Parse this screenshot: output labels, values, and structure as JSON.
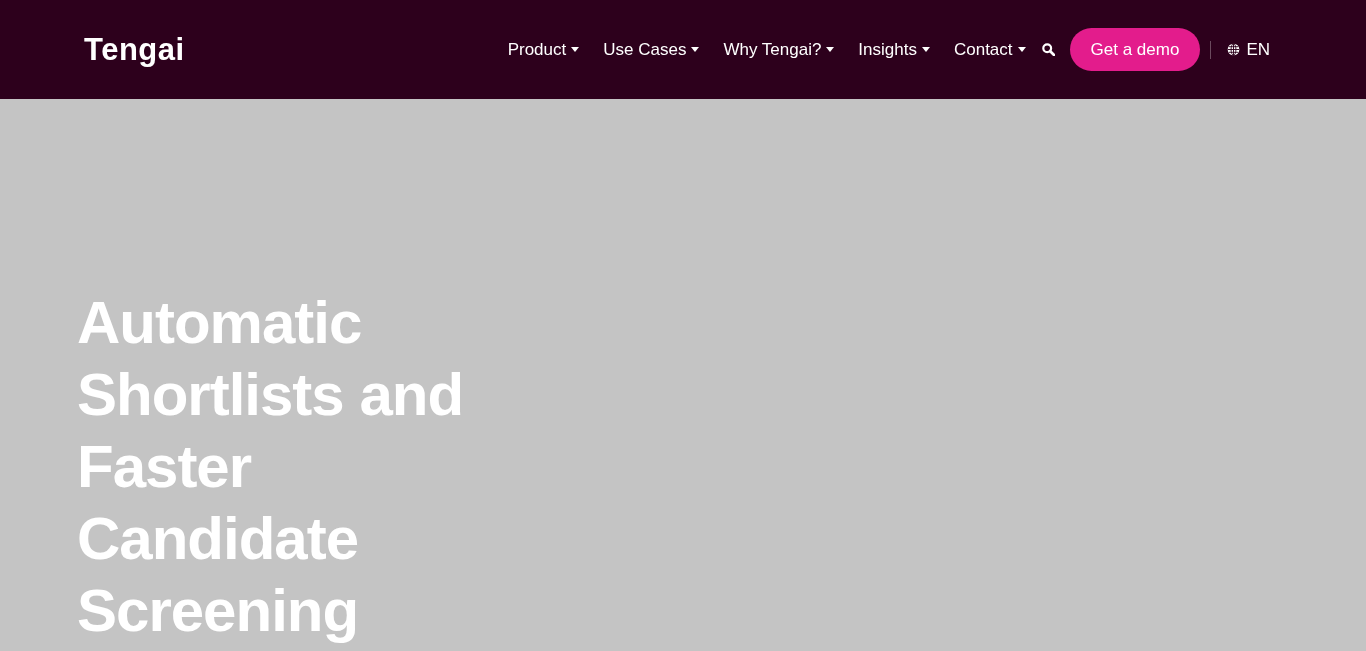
{
  "header": {
    "logo": "Tengai",
    "nav": [
      {
        "label": "Product"
      },
      {
        "label": "Use Cases"
      },
      {
        "label": "Why Tengai?"
      },
      {
        "label": "Insights"
      },
      {
        "label": "Contact"
      }
    ],
    "cta": "Get a demo",
    "language": "EN"
  },
  "hero": {
    "heading": "Automatic Shortlists and Faster Candidate Screening"
  }
}
